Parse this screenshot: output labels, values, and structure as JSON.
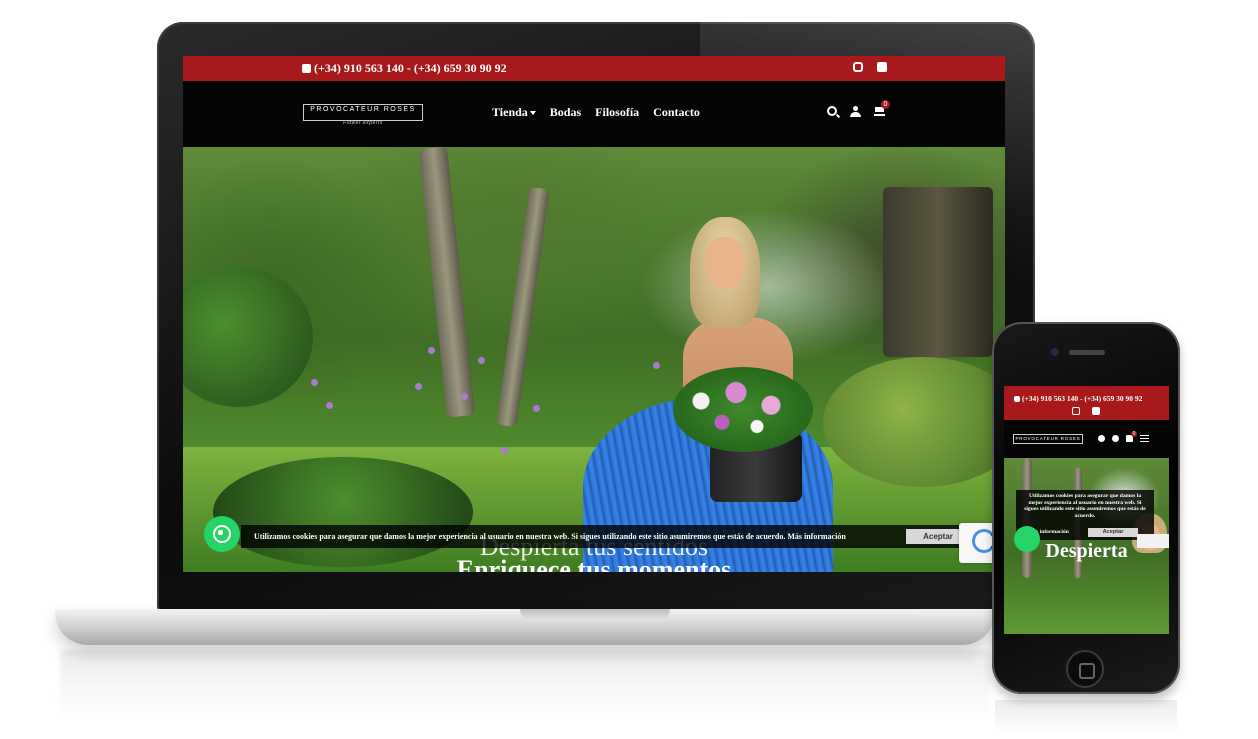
{
  "desktop": {
    "topbar": {
      "phones": "(+34) 910 563 140 - (+34) 659 30 90 92",
      "background": "#a8191c"
    },
    "logo": {
      "name": "PROVOCATEUR ROSES",
      "tagline": "Flower experts"
    },
    "nav": {
      "items": [
        {
          "label": "Tienda",
          "has_dropdown": true
        },
        {
          "label": "Bodas"
        },
        {
          "label": "Filosofía"
        },
        {
          "label": "Contacto"
        }
      ],
      "cart_count": "0"
    },
    "hero": {
      "line1": "Despierta tus sentidos",
      "line2": "Enriquece tus momentos"
    },
    "cookie": {
      "text": "Utilizamos cookies para asegurar que damos la mejor experiencia al usuario en nuestra web. Si sigues utilizando este sitio asumiremos que estás de acuerdo.",
      "more": "Más información",
      "accept": "Aceptar"
    }
  },
  "mobile": {
    "topbar": {
      "phones": "(+34) 910 563 140 - (+34) 659 30 90 92"
    },
    "logo": {
      "name": "PROVOCATEUR ROSES"
    },
    "cart_count": "0",
    "cookie": {
      "text": "Utilizamos cookies para asegurar que damos la mejor experiencia al usuario en nuestra web. Si sigues utilizando este sitio asumiremos que estás de acuerdo.",
      "more": "Más información",
      "accept": "Aceptar"
    },
    "hero": {
      "title": "Despierta"
    }
  },
  "icons": {
    "whatsapp": "whatsapp-icon",
    "instagram": "instagram-icon",
    "facebook": "facebook-icon",
    "search": "search-icon",
    "user": "user-icon",
    "cart": "cart-icon",
    "menu": "hamburger-menu-icon"
  },
  "colors": {
    "brand_red": "#a8191c",
    "whatsapp_green": "#25d366",
    "nav_bg": "#050505"
  }
}
